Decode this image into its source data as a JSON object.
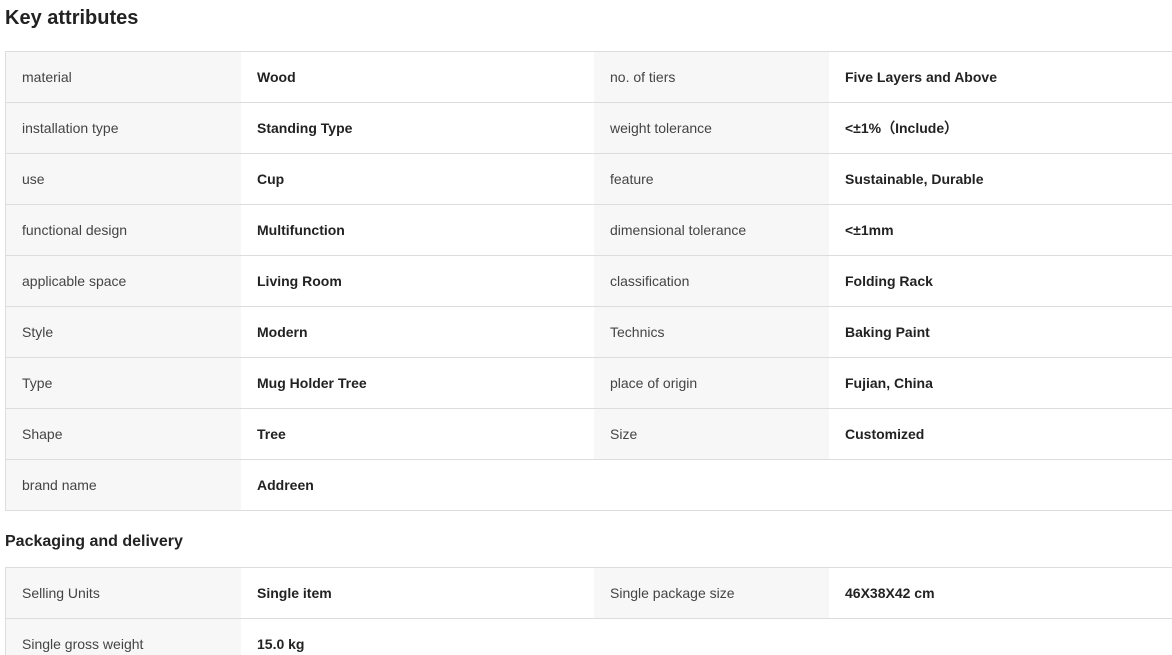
{
  "key_attributes": {
    "title": "Key attributes",
    "rows": [
      {
        "label1": "material",
        "value1": "Wood",
        "label2": "no. of tiers",
        "value2": "Five Layers and Above"
      },
      {
        "label1": "installation type",
        "value1": "Standing Type",
        "label2": "weight tolerance",
        "value2": "<±1%（Include）"
      },
      {
        "label1": "use",
        "value1": "Cup",
        "label2": "feature",
        "value2": "Sustainable, Durable"
      },
      {
        "label1": "functional design",
        "value1": "Multifunction",
        "label2": "dimensional tolerance",
        "value2": "<±1mm"
      },
      {
        "label1": "applicable space",
        "value1": "Living Room",
        "label2": "classification",
        "value2": "Folding Rack"
      },
      {
        "label1": "Style",
        "value1": "Modern",
        "label2": "Technics",
        "value2": "Baking Paint"
      },
      {
        "label1": "Type",
        "value1": "Mug Holder Tree",
        "label2": "place of origin",
        "value2": "Fujian, China"
      },
      {
        "label1": "Shape",
        "value1": "Tree",
        "label2": "Size",
        "value2": "Customized"
      },
      {
        "label1": "brand name",
        "value1": "Addreen"
      }
    ]
  },
  "packaging": {
    "title": "Packaging and delivery",
    "rows": [
      {
        "label1": "Selling Units",
        "value1": "Single item",
        "label2": "Single package size",
        "value2": "46X38X42 cm"
      },
      {
        "label1": "Single gross weight",
        "value1": "15.0 kg"
      }
    ]
  }
}
